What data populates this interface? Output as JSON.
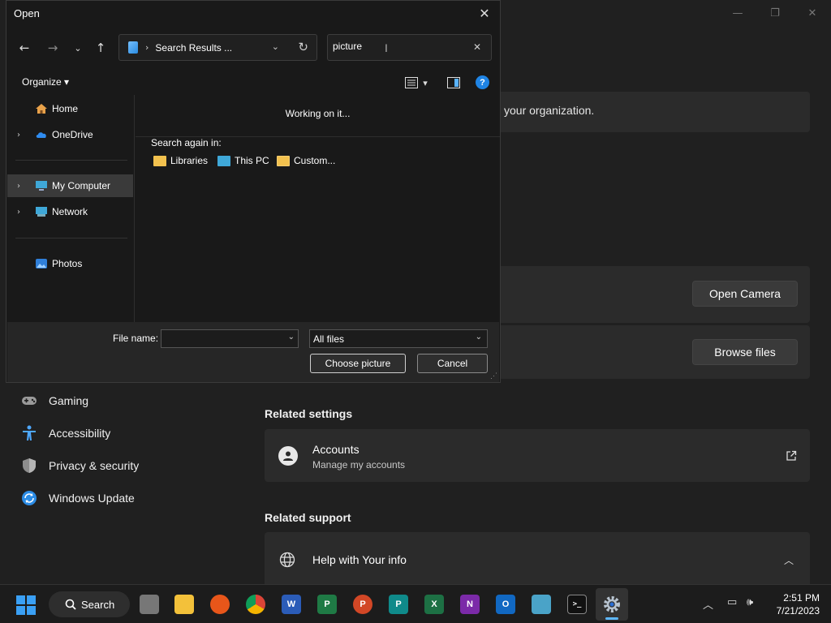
{
  "settings": {
    "org_text": "your organization.",
    "open_camera_label": "Open Camera",
    "browse_files_label": "Browse files",
    "nav": [
      {
        "label": "Gaming"
      },
      {
        "label": "Accessibility"
      },
      {
        "label": "Privacy & security"
      },
      {
        "label": "Windows Update"
      }
    ],
    "related_settings_heading": "Related settings",
    "accounts_title": "Accounts",
    "accounts_sub": "Manage my accounts",
    "related_support_heading": "Related support",
    "help_title": "Help with Your info"
  },
  "dialog": {
    "title": "Open",
    "address": "Search Results ...",
    "search_value": "picture",
    "organize_label": "Organize ▾",
    "nav_items": [
      {
        "label": "Home"
      },
      {
        "label": "OneDrive"
      },
      {
        "label": "My Computer"
      },
      {
        "label": "Network"
      },
      {
        "label": "Photos"
      }
    ],
    "working_text": "Working on it...",
    "search_again_label": "Search again in:",
    "search_again_items": [
      {
        "label": "Libraries"
      },
      {
        "label": "This PC"
      },
      {
        "label": "Custom..."
      }
    ],
    "file_name_label": "File name:",
    "file_name_value": "",
    "file_type_value": "All files",
    "choose_label": "Choose picture",
    "cancel_label": "Cancel"
  },
  "taskbar": {
    "search_label": "Search",
    "time": "2:51 PM",
    "date": "7/21/2023"
  },
  "colors": {
    "accent": "#1f84e5",
    "background": "#202020",
    "dialog_bg": "#191919"
  }
}
